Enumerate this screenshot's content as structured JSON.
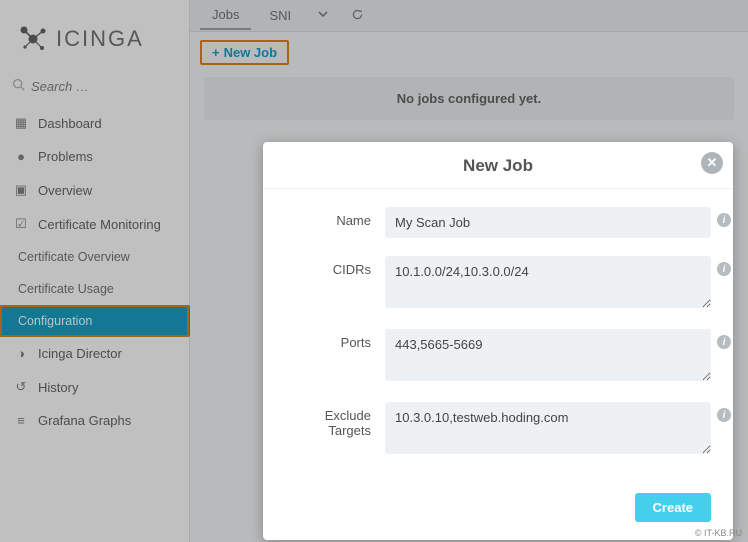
{
  "logo_text": "ICINGA",
  "search_placeholder": "Search …",
  "nav": {
    "dashboard": "Dashboard",
    "problems": "Problems",
    "overview": "Overview",
    "cert_monitoring": "Certificate Monitoring",
    "cert_overview": "Certificate Overview",
    "cert_usage": "Certificate Usage",
    "configuration": "Configuration",
    "director": "Icinga Director",
    "history": "History",
    "grafana": "Grafana Graphs"
  },
  "tabs": {
    "jobs": "Jobs",
    "sni": "SNI"
  },
  "toolbar": {
    "new_job": "New Job"
  },
  "empty_msg": "No jobs configured yet.",
  "modal": {
    "title": "New Job",
    "labels": {
      "name": "Name",
      "cidrs": "CIDRs",
      "ports": "Ports",
      "exclude": "Exclude Targets"
    },
    "values": {
      "name": "My Scan Job",
      "cidrs": "10.1.0.0/24,10.3.0.0/24",
      "ports": "443,5665-5669",
      "exclude": "10.3.0.10,testweb.hoding.com"
    },
    "create": "Create"
  },
  "watermark": "© IT-KB.RU"
}
